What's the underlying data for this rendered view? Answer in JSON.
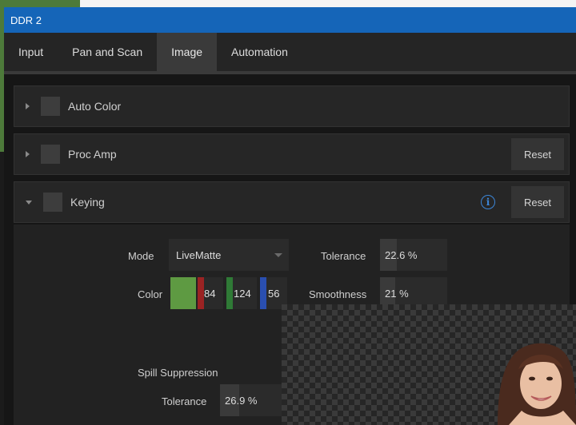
{
  "window": {
    "title": "DDR 2"
  },
  "tabs": [
    {
      "label": "Input",
      "active": false
    },
    {
      "label": "Pan and Scan",
      "active": false
    },
    {
      "label": "Image",
      "active": true
    },
    {
      "label": "Automation",
      "active": false
    }
  ],
  "sections": {
    "auto_color": {
      "label": "Auto Color",
      "expanded": false
    },
    "proc_amp": {
      "label": "Proc Amp",
      "expanded": false,
      "reset_label": "Reset"
    },
    "keying": {
      "label": "Keying",
      "expanded": true,
      "reset_label": "Reset",
      "info_glyph": "i"
    }
  },
  "keying": {
    "mode_label": "Mode",
    "mode_value": "LiveMatte",
    "color_label": "Color",
    "color_swatch": "#5e9a42",
    "color_r": "84",
    "color_g": "124",
    "color_b": "56",
    "tolerance_label": "Tolerance",
    "tolerance_value": "22.6 %",
    "tolerance_fraction": 0.226,
    "smoothness_label": "Smoothness",
    "smoothness_value": "21 %",
    "smoothness_fraction": 0.21,
    "spill_label": "Spill Suppression",
    "spill_tolerance_label": "Tolerance",
    "spill_tolerance_value": "26.9 %",
    "spill_tolerance_fraction": 0.269
  },
  "icons": {
    "expand": "triangle-right",
    "collapse": "triangle-down",
    "info": "info-circle"
  },
  "colors": {
    "titlebar": "#1565b8",
    "accent": "#3c86d8",
    "red_channel": "#9b2323",
    "green_channel": "#2f7a36",
    "blue_channel": "#2a4fb0"
  }
}
